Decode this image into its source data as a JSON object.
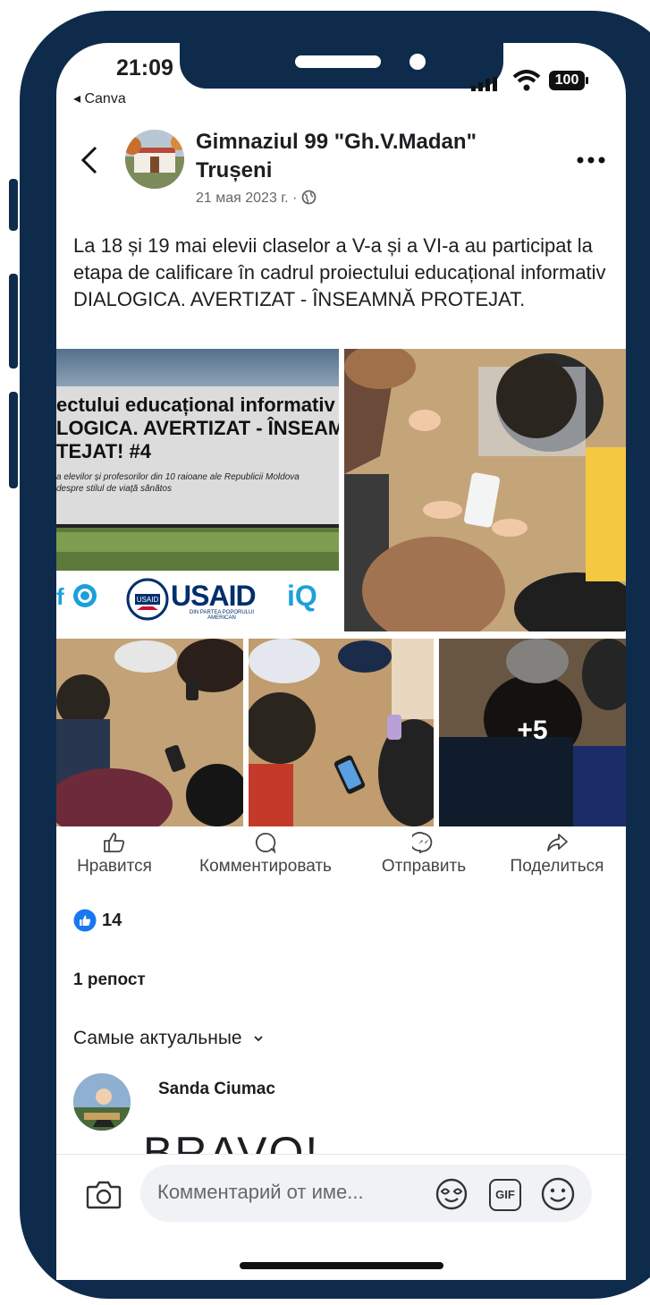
{
  "status_bar": {
    "time": "21:09",
    "back_app": "◂ Canva",
    "battery": "100"
  },
  "post": {
    "page_name": "Gimnaziul 99 \"Gh.V.Madan\" Trușeni",
    "date": "21 мая 2023 г. ·",
    "text": "La 18 și 19 mai elevii claselor a V-a și a VI-a au participat la etapa de calificare în cadrul proiectului educațional informativ DIALOGICA. AVERTIZAT - ÎNSEAMNĂ PROTEJAT.",
    "banner": {
      "line1": "ectului educațional informativ",
      "line2": "LOGICA. AVERTIZAT - ÎNSEAM",
      "line3": "TEJAT! #4",
      "sub1": "a elevilor și profesorilor din 10 raioane ale Republicii Moldova",
      "sub2": "despre stilul de viață sănătos",
      "logo_usaid": "USAID",
      "logo_usaid_sub": "DIN PARTEA POPORULUI AMERICAN",
      "logo_iq": "iQ",
      "logo_usaid_seal": "USAID"
    },
    "more_photos": "+5"
  },
  "actions": {
    "like": "Нравится",
    "comment": "Комментировать",
    "send": "Отправить",
    "share": "Поделиться"
  },
  "stats": {
    "likes": "14",
    "reposts": "1 репост"
  },
  "comments": {
    "sort_label": "Самые актуальные",
    "first": {
      "author": "Sanda Ciumac",
      "text": "BRAVO!"
    }
  },
  "composer": {
    "placeholder": "Комментарий от име...",
    "gif": "GIF"
  },
  "colors": {
    "frame": "#0f2b4b",
    "like_blue": "#1877f2",
    "usaid_red": "#c8102e",
    "usaid_blue": "#002f6c"
  }
}
